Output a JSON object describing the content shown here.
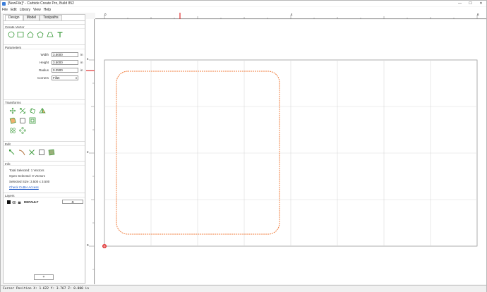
{
  "window": {
    "title": "[NewFile]* - Carbide Create Pro, Build 852",
    "minimize_glyph": "—",
    "maximize_glyph": "☐",
    "close_glyph": "✕"
  },
  "menu": [
    "File",
    "Edit",
    "Library",
    "View",
    "Help"
  ],
  "tabs": [
    "Design",
    "Model",
    "Toolpaths"
  ],
  "sections": {
    "create_vector": "Create Vector",
    "parameters": "Parameters",
    "transforms": "Transforms",
    "edit": "Edit",
    "info": "Info",
    "layers": "Layers"
  },
  "parameters": {
    "width_label": "Width",
    "width_value": "3.5000",
    "height_label": "Height",
    "height_value": "3.5000",
    "radius_label": "Radius",
    "radius_value": "0.2500",
    "unit": "in",
    "corners_label": "Corners",
    "corners_value": "Fillet"
  },
  "info": {
    "total_selected": "Total Selected:   1 Vectors",
    "open_selected": "Open Selected:   0 Vectors",
    "selected_size": "Selected Size:   3.500 x 3.500",
    "check_cutter_access": "Check Cutter Access"
  },
  "layers": {
    "items": [
      {
        "name": "DEFAULT",
        "color": "#111111"
      }
    ],
    "settings_glyph": "⚙",
    "add_label": "+"
  },
  "rulers": {
    "top_labels": [
      "0",
      "4",
      "6"
    ],
    "left_labels": [
      "4",
      "2",
      "0"
    ]
  },
  "status": {
    "cursor_position": "Cursor Position X: 1.622 Y: 3.767 Z: 0.000 in"
  },
  "colors": {
    "icon_green": "#3a9a3a",
    "vector_orange": "#f07c3c",
    "ruler_marker_red": "#e03030",
    "grid_line": "#d9d9d9"
  },
  "icons": {
    "create_vector": [
      "circle-icon",
      "rectangle-icon",
      "polygon-icon",
      "pentagon-icon",
      "polygon-alt-icon",
      "text-icon"
    ],
    "transforms_row1": [
      "move-icon",
      "scale-icon",
      "rotate-icon",
      "mirror-icon"
    ],
    "transforms_row2": [
      "fillet-icon",
      "offset-icon",
      "boolean-icon"
    ],
    "transforms_row3": [
      "array-icon",
      "circular-array-icon"
    ],
    "edit": [
      "node-edit-icon",
      "curve-icon",
      "trim-icon",
      "join-icon",
      "boundary-icon"
    ]
  }
}
